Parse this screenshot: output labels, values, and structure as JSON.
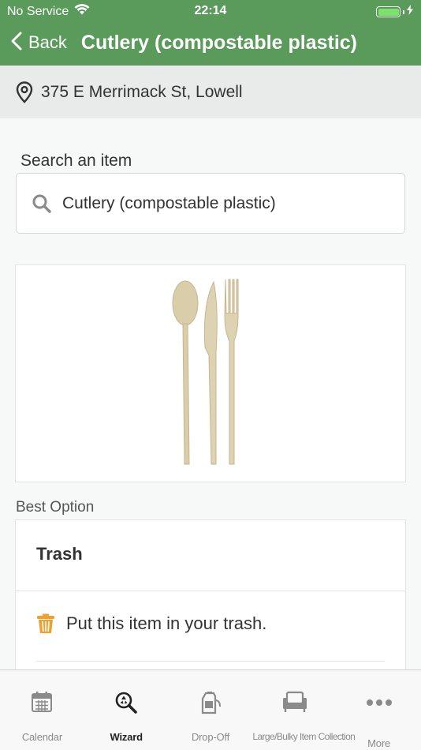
{
  "status_bar": {
    "carrier": "No Service",
    "time": "22:14"
  },
  "nav": {
    "back_label": "Back",
    "title": "Cutlery (compostable plastic)"
  },
  "address": {
    "text": "375 E Merrimack St, Lowell"
  },
  "search": {
    "label": "Search an item",
    "value": "Cutlery (compostable plastic)",
    "icon": "search-icon"
  },
  "item_image": {
    "depicts": [
      "spoon",
      "knife",
      "fork"
    ]
  },
  "best_option": {
    "label": "Best Option",
    "title": "Trash",
    "instruction": "Put this item in your trash.",
    "instruction_icon": "trash-can-icon"
  },
  "tabs": [
    {
      "label": "Calendar",
      "icon": "calendar-icon",
      "active": false
    },
    {
      "label": "Wizard",
      "icon": "wizard-search-icon",
      "active": true
    },
    {
      "label": "Drop-Off",
      "icon": "drop-off-icon",
      "active": false
    },
    {
      "label": "Large/Bulky Item Collection",
      "icon": "armchair-icon",
      "active": false
    },
    {
      "label": "More",
      "icon": "more-icon",
      "active": false
    }
  ],
  "colors": {
    "header_green": "#5a9a5a",
    "battery_green": "#7be36b",
    "trash_icon_orange": "#f0a030"
  }
}
